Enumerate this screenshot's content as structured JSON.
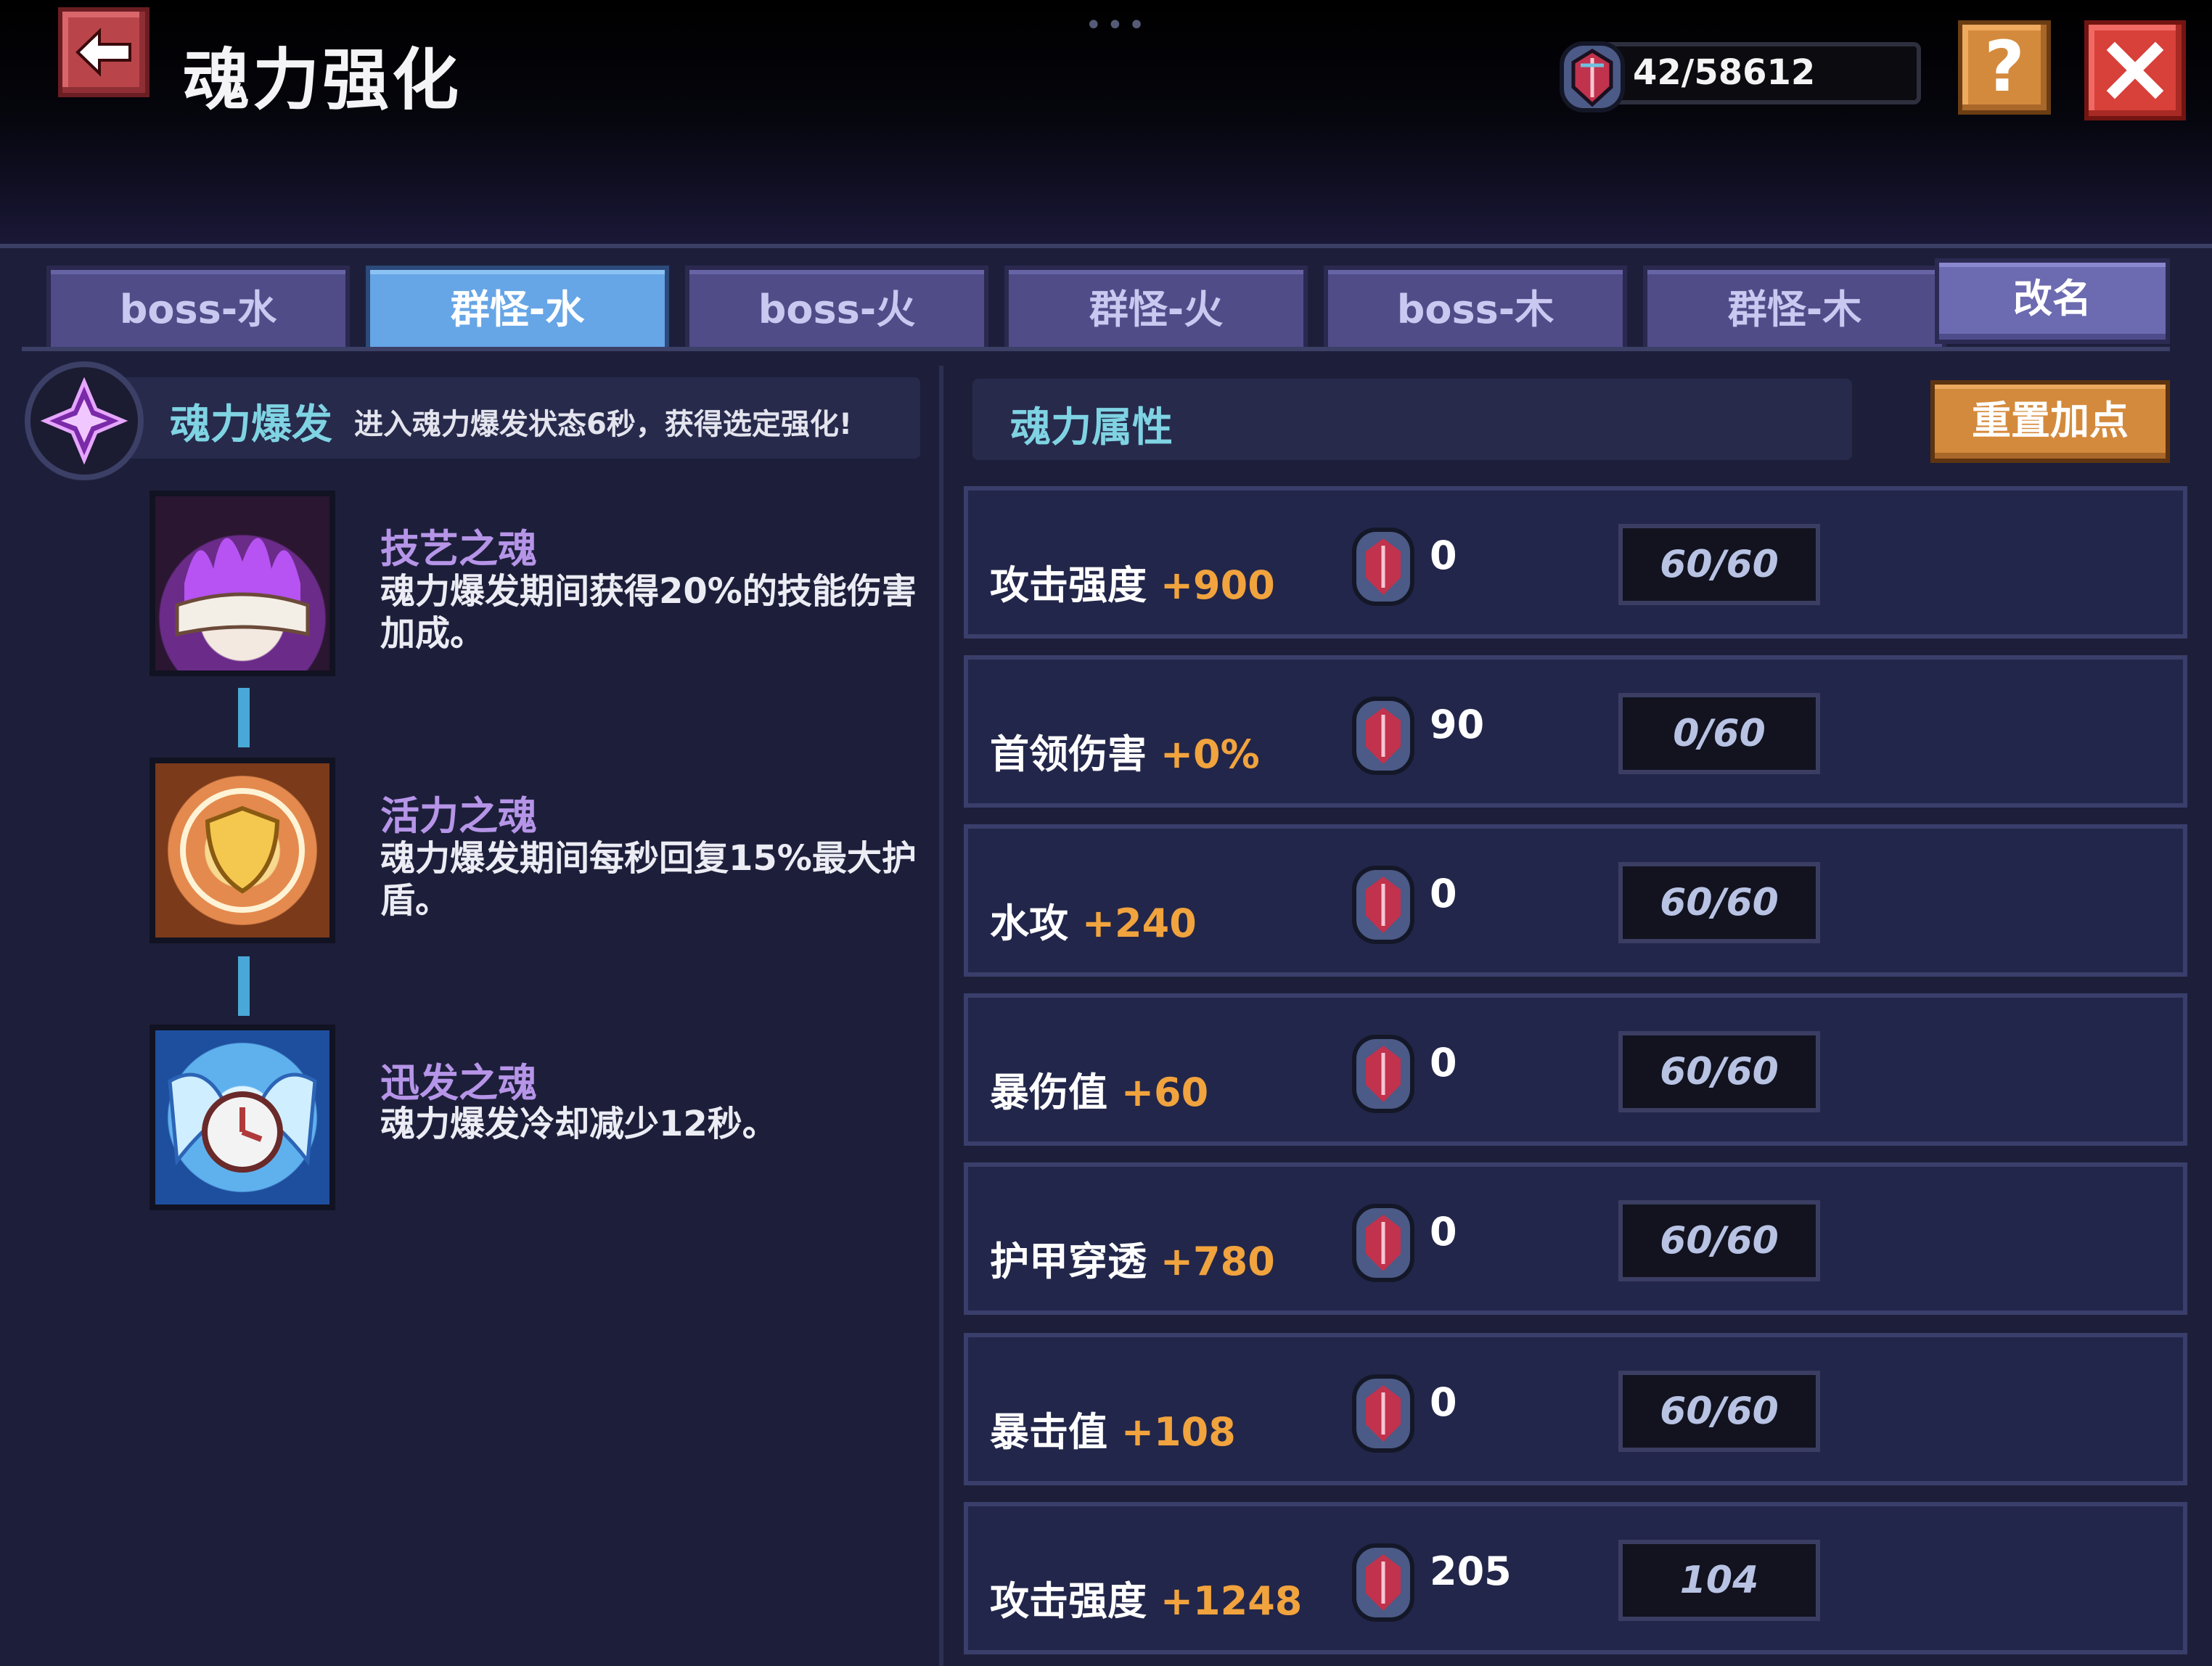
{
  "header": {
    "title": "魂力强化",
    "currency": "42/58612",
    "help_label": "?"
  },
  "tabs": [
    {
      "label": "boss-水",
      "active": false
    },
    {
      "label": "群怪-水",
      "active": true
    },
    {
      "label": "boss-火",
      "active": false
    },
    {
      "label": "群怪-火",
      "active": false
    },
    {
      "label": "boss-木",
      "active": false
    },
    {
      "label": "群怪-木",
      "active": false
    }
  ],
  "rename_label": "改名",
  "burst": {
    "title": "魂力爆发",
    "description": "进入魂力爆发状态6秒，获得选定强化!"
  },
  "souls": [
    {
      "name": "技艺之魂",
      "description": "魂力爆发期间获得20%的技能伤害加成。",
      "icon": "purple-flame-book-icon"
    },
    {
      "name": "活力之魂",
      "description": "魂力爆发期间每秒回复15%最大护盾。",
      "icon": "golden-shield-icon"
    },
    {
      "name": "迅发之魂",
      "description": "魂力爆发冷却减少12秒。",
      "icon": "winged-clock-icon"
    }
  ],
  "attributes": {
    "header": "魂力属性",
    "reset_label": "重置加点",
    "rows": [
      {
        "name": "攻击强度",
        "bonus": "+900",
        "cost": "0",
        "level": "60/60"
      },
      {
        "name": "首领伤害",
        "bonus": "+0%",
        "cost": "90",
        "level": "0/60"
      },
      {
        "name": "水攻",
        "bonus": "+240",
        "cost": "0",
        "level": "60/60"
      },
      {
        "name": "暴伤值",
        "bonus": "+60",
        "cost": "0",
        "level": "60/60"
      },
      {
        "name": "护甲穿透",
        "bonus": "+780",
        "cost": "0",
        "level": "60/60"
      },
      {
        "name": "暴击值",
        "bonus": "+108",
        "cost": "0",
        "level": "60/60"
      },
      {
        "name": "攻击强度",
        "bonus": "+1248",
        "cost": "205",
        "level": "104"
      }
    ]
  },
  "colors": {
    "accent_cyan": "#7fd3e3",
    "bonus_orange": "#f1a33e",
    "soul_name_purple": "#b695e8",
    "active_tab": "#66a5e6"
  }
}
